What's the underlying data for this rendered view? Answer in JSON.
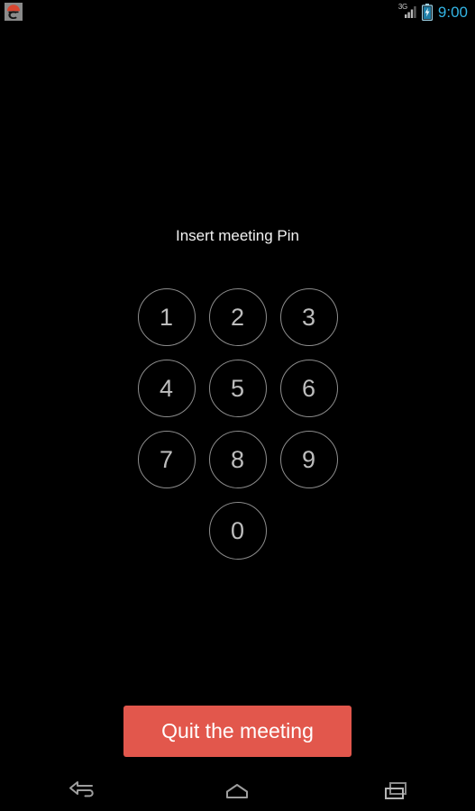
{
  "status_bar": {
    "notification_icon": "app-notification-icon",
    "signal_label": "3G",
    "signal_icon": "signal-bars-icon",
    "battery_icon": "battery-charging-icon",
    "clock": "9:00",
    "clock_color": "#33b5e5"
  },
  "screen": {
    "background_color": "#000000",
    "title": "Insert meeting Pin"
  },
  "keypad": {
    "rows": [
      [
        "1",
        "2",
        "3"
      ],
      [
        "4",
        "5",
        "6"
      ],
      [
        "7",
        "8",
        "9"
      ],
      [
        "0"
      ]
    ],
    "key_border_color": "#8c8c8c",
    "key_text_color": "#bdbdbd"
  },
  "actions": {
    "quit_label": "Quit the meeting",
    "quit_color": "#e2574c",
    "quit_text_color": "#ffffff"
  },
  "nav_bar": {
    "back_icon": "back-arrow-icon",
    "home_icon": "home-icon",
    "recents_icon": "recent-apps-icon"
  }
}
